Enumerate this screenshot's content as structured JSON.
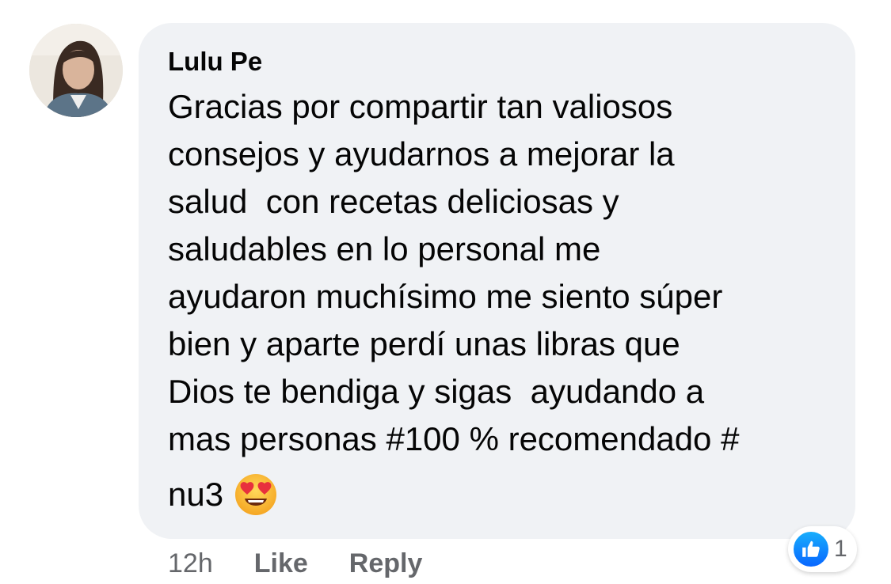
{
  "comment": {
    "author": "Lulu Pe",
    "text_lines": [
      "Gracias por compartir tan valiosos",
      "consejos y ayudarnos a mejorar la",
      "salud  con recetas deliciosas y",
      "saludables en lo personal me",
      "ayudaron muchísimo me siento súper",
      "bien y aparte perdí unas libras que",
      "Dios te bendiga y sigas  ayudando a",
      "mas personas #100 % recomendado #"
    ],
    "last_line": "nu3",
    "emoji": "heart-eyes-emoji",
    "timestamp": "12h",
    "like_label": "Like",
    "reply_label": "Reply",
    "reaction_icon": "like-icon",
    "reaction_count": "1"
  },
  "colors": {
    "bubble": "#f0f2f5",
    "text": "#050505",
    "meta": "#65676b",
    "like_blue": "#0866ff"
  }
}
